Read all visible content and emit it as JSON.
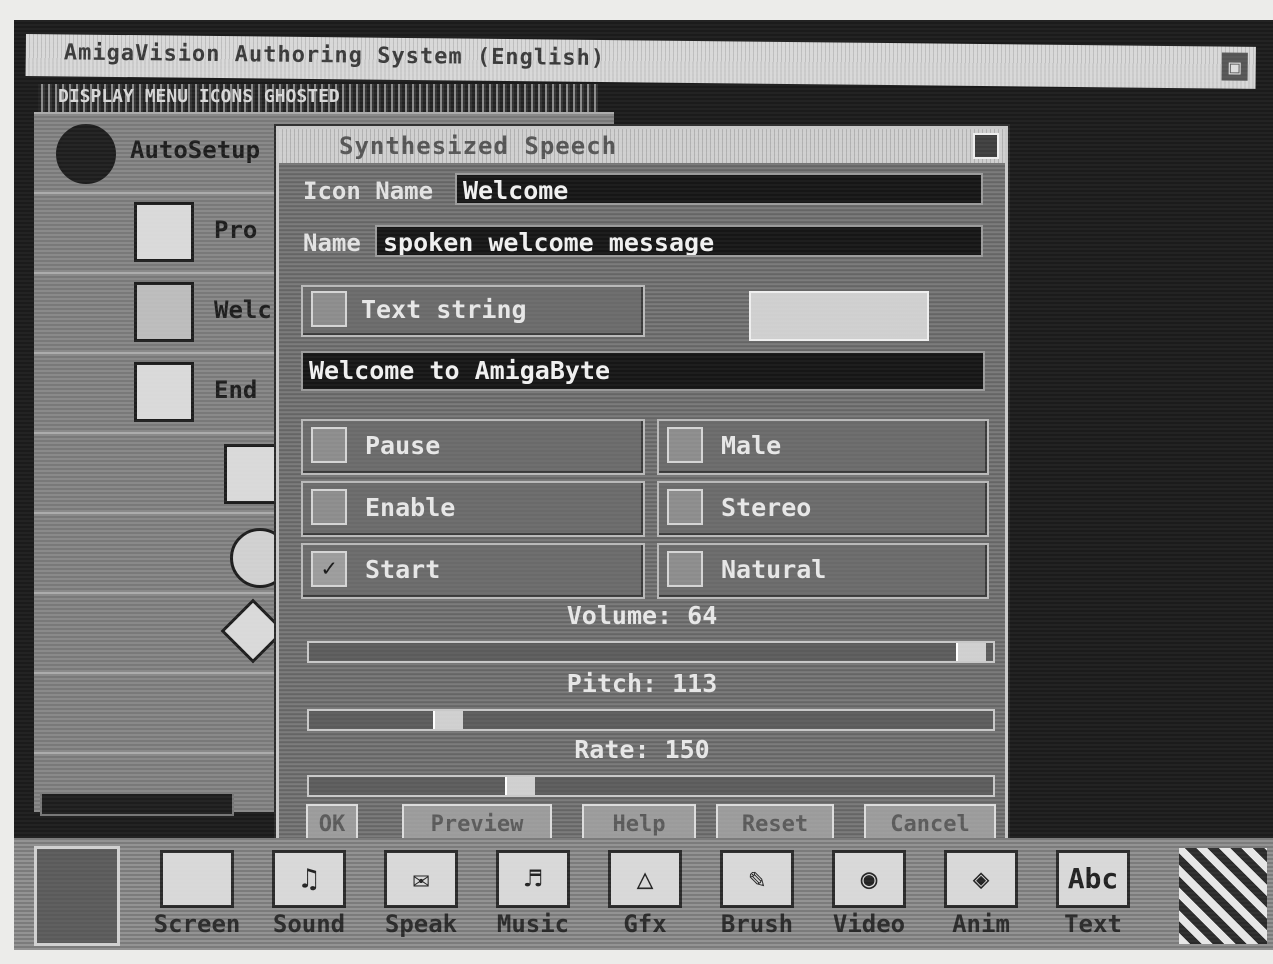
{
  "window": {
    "title": "AmigaVision Authoring System (English)",
    "menu_text": "DISPLAY MENU ICONS GHOSTED"
  },
  "flow": {
    "items": [
      {
        "label": "AutoSetup",
        "icon": "circle-icon"
      },
      {
        "label": "Pro",
        "icon": "document-icon"
      },
      {
        "label": "Welc",
        "icon": "speech-icon"
      },
      {
        "label": "End",
        "icon": "return-arrow-icon"
      }
    ]
  },
  "dialog": {
    "title": "Synthesized Speech",
    "icon_name_label": "Icon Name",
    "icon_name_value": "Welcome",
    "name_label": "Name",
    "name_value": "spoken welcome message",
    "text_string_label": "Text string",
    "text_string_value": "Welcome to AmigaByte",
    "options": [
      {
        "label": "Pause",
        "checked": false
      },
      {
        "label": "Male",
        "checked": false
      },
      {
        "label": "Enable",
        "checked": false
      },
      {
        "label": "Stereo",
        "checked": false
      },
      {
        "label": "Start",
        "checked": true
      },
      {
        "label": "Natural",
        "checked": false
      }
    ],
    "volume_label": "Volume:",
    "volume_value": "64",
    "volume_fraction": 0.99,
    "pitch_label": "Pitch:",
    "pitch_value": "113",
    "pitch_fraction": 0.19,
    "rate_label": "Rate:",
    "rate_value": "150",
    "rate_fraction": 0.3,
    "buttons": {
      "ok": "OK",
      "preview": "Preview",
      "help": "Help",
      "reset": "Reset",
      "cancel": "Cancel"
    }
  },
  "toolbar": {
    "items": [
      {
        "label": "Screen",
        "icon": "screen-icon"
      },
      {
        "label": "Sound",
        "icon": "sound-icon"
      },
      {
        "label": "Speak",
        "icon": "speak-icon"
      },
      {
        "label": "Music",
        "icon": "music-icon"
      },
      {
        "label": "Gfx",
        "icon": "gfx-icon"
      },
      {
        "label": "Brush",
        "icon": "brush-icon"
      },
      {
        "label": "Video",
        "icon": "video-icon"
      },
      {
        "label": "Anim",
        "icon": "anim-icon"
      },
      {
        "label": "Text",
        "icon": "text-icon",
        "icon_text": "Abc"
      }
    ]
  }
}
